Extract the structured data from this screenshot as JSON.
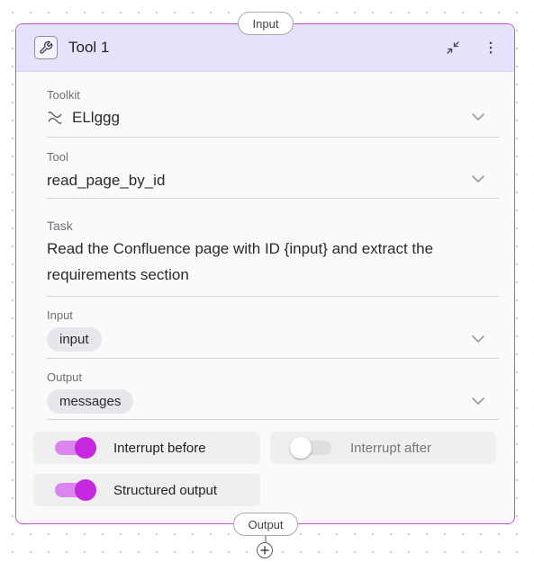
{
  "node": {
    "title": "Tool 1",
    "input_port_label": "Input",
    "output_port_label": "Output",
    "accent_color": "#c94fe0",
    "header_color": "#e5e3fb",
    "icon": "wrench-icon"
  },
  "fields": {
    "toolkit": {
      "label": "Toolkit",
      "value": "ELlggg",
      "icon": "confluence-icon"
    },
    "tool": {
      "label": "Tool",
      "value": "read_page_by_id"
    },
    "task": {
      "label": "Task",
      "line1": "Read the Confluence page with ID {input} and extract the",
      "line2": "requirements section"
    },
    "input": {
      "label": "Input",
      "value": "input"
    },
    "output": {
      "label": "Output",
      "value": "messages"
    }
  },
  "toggles": {
    "interrupt_before": {
      "label": "Interrupt before",
      "on": true
    },
    "interrupt_after": {
      "label": "Interrupt after",
      "on": false
    },
    "structured_output": {
      "label": "Structured output",
      "on": true
    }
  }
}
